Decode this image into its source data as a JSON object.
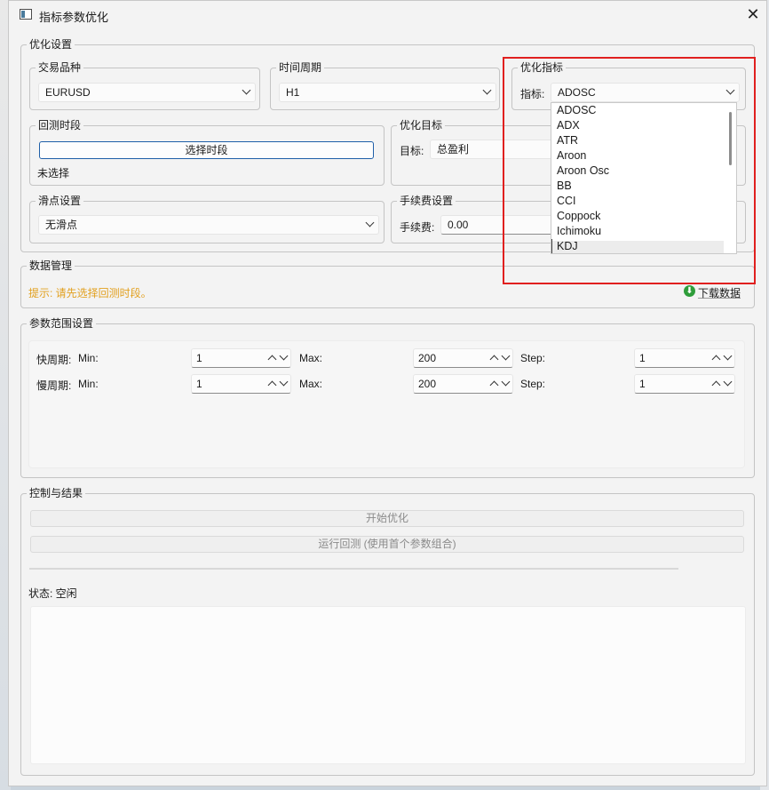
{
  "window": {
    "title": "指标参数优化",
    "close": "✕"
  },
  "opt": {
    "group": "优化设置",
    "symbol_group": "交易品种",
    "symbol_value": "EURUSD",
    "period_group": "时间周期",
    "period_value": "H1",
    "indicator_group": "优化指标",
    "indicator_label": "指标:",
    "indicator_value": "ADOSC",
    "indicator_options": [
      "ADOSC",
      "ADX",
      "ATR",
      "Aroon",
      "Aroon Osc",
      "BB",
      "CCI",
      "Coppock",
      "Ichimoku",
      "KDJ"
    ],
    "backtest_group": "回测时段",
    "select_period_btn": "选择时段",
    "backtest_status": "未选择",
    "target_group": "优化目标",
    "target_label": "目标:",
    "target_value": "总盈利",
    "slippage_group": "滑点设置",
    "slippage_value": "无滑点",
    "fee_group": "手续费设置",
    "fee_label": "手续费:",
    "fee_value": "0.00"
  },
  "data_mgmt": {
    "group": "数据管理",
    "hint": "提示: 请先选择回测时段。",
    "download_btn": "下载数据",
    "hint_color": "#e2a01f"
  },
  "params": {
    "group": "参数范围设置",
    "rows": [
      {
        "label": "快周期:",
        "min_label": "Min:",
        "min": "1",
        "max_label": "Max:",
        "max": "200",
        "step_label": "Step:",
        "step": "1"
      },
      {
        "label": "慢周期:",
        "min_label": "Min:",
        "min": "1",
        "max_label": "Max:",
        "max": "200",
        "step_label": "Step:",
        "step": "1"
      }
    ]
  },
  "control": {
    "group": "控制与结果",
    "start_btn": "开始优化",
    "run_btn": "运行回测 (使用首个参数组合)",
    "status": "状态: 空闲",
    "progress": 0
  }
}
